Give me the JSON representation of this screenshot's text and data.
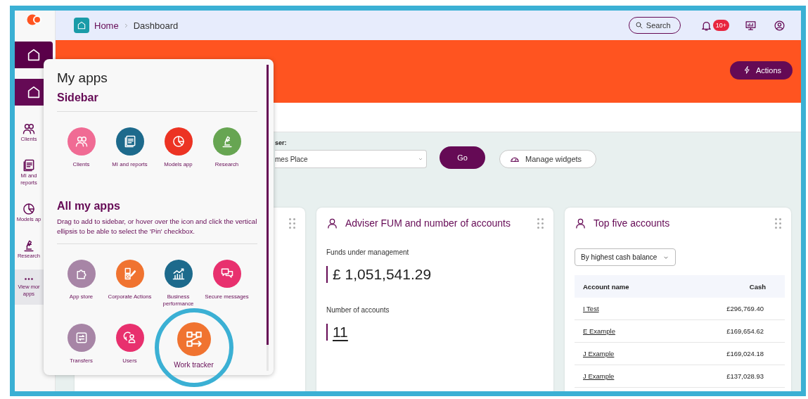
{
  "sidebar": {
    "items": [
      {
        "kind": "tile",
        "selected": true
      },
      {
        "kind": "tile",
        "selected": false
      },
      {
        "kind": "link",
        "label": "Clients"
      },
      {
        "kind": "link",
        "label": "MI and reports"
      },
      {
        "kind": "link",
        "label": "Models ap"
      },
      {
        "kind": "link",
        "label": "Research"
      },
      {
        "kind": "more",
        "label": "View mor\napps"
      }
    ]
  },
  "topbar": {
    "breadcrumb": [
      {
        "label": "Home"
      },
      {
        "label": "Dashboard"
      }
    ],
    "search": {
      "label": "Search"
    },
    "notifications_badge": "10+"
  },
  "banner": {
    "actions_button": "Actions"
  },
  "adviser_picker": {
    "label": "ser:",
    "value": "mes Place",
    "go_button": "Go",
    "manage_button": "Manage widgets"
  },
  "cards": [
    {
      "kind": "blank"
    },
    {
      "kind": "fum",
      "title": "Adviser FUM and number of accounts",
      "fields": [
        {
          "label": "Funds under management",
          "value": "£ 1,051,541.29",
          "link": false
        },
        {
          "label": "Number of accounts",
          "value": "11",
          "link": true
        }
      ]
    },
    {
      "kind": "table",
      "title": "Top five accounts",
      "sort": "By highest cash balance",
      "table": {
        "columns": [
          "Account name",
          "Cash"
        ],
        "rows": [
          [
            "I Test",
            "£296,769.40"
          ],
          [
            "E Example",
            "£169,654.62"
          ],
          [
            "J Example",
            "£169,024.18"
          ],
          [
            "J Example",
            "£137,028.93"
          ]
        ]
      }
    }
  ],
  "popup": {
    "title": "My apps",
    "sections": [
      {
        "title": "Sidebar",
        "apps": [
          {
            "label": "Clients",
            "color": "#f06b94",
            "highlighted": false
          },
          {
            "label": "MI and reports",
            "color": "#1d6a8c",
            "highlighted": false
          },
          {
            "label": "Models app",
            "color": "#ec3323",
            "highlighted": false
          },
          {
            "label": "Research",
            "color": "#67a552",
            "highlighted": false
          }
        ]
      },
      {
        "title": "All my apps",
        "description": "Drag to add to sidebar, or hover over the icon and click the vertical ellipsis to be able to select the 'Pin' checkbox.",
        "apps": [
          {
            "label": "App store",
            "color": "#a785a6",
            "highlighted": false
          },
          {
            "label": "Corporate Actions",
            "color": "#f07330",
            "highlighted": false
          },
          {
            "label": "Business performance",
            "color": "#1d6a8c",
            "highlighted": false
          },
          {
            "label": "Secure messages",
            "color": "#e8306e",
            "highlighted": false
          },
          {
            "label": "Transfers",
            "color": "#a785a6",
            "highlighted": false
          },
          {
            "label": "Users",
            "color": "#e8306e",
            "highlighted": false
          },
          {
            "label": "Work tracker",
            "color": "#f07330",
            "highlighted": true
          }
        ]
      }
    ]
  }
}
